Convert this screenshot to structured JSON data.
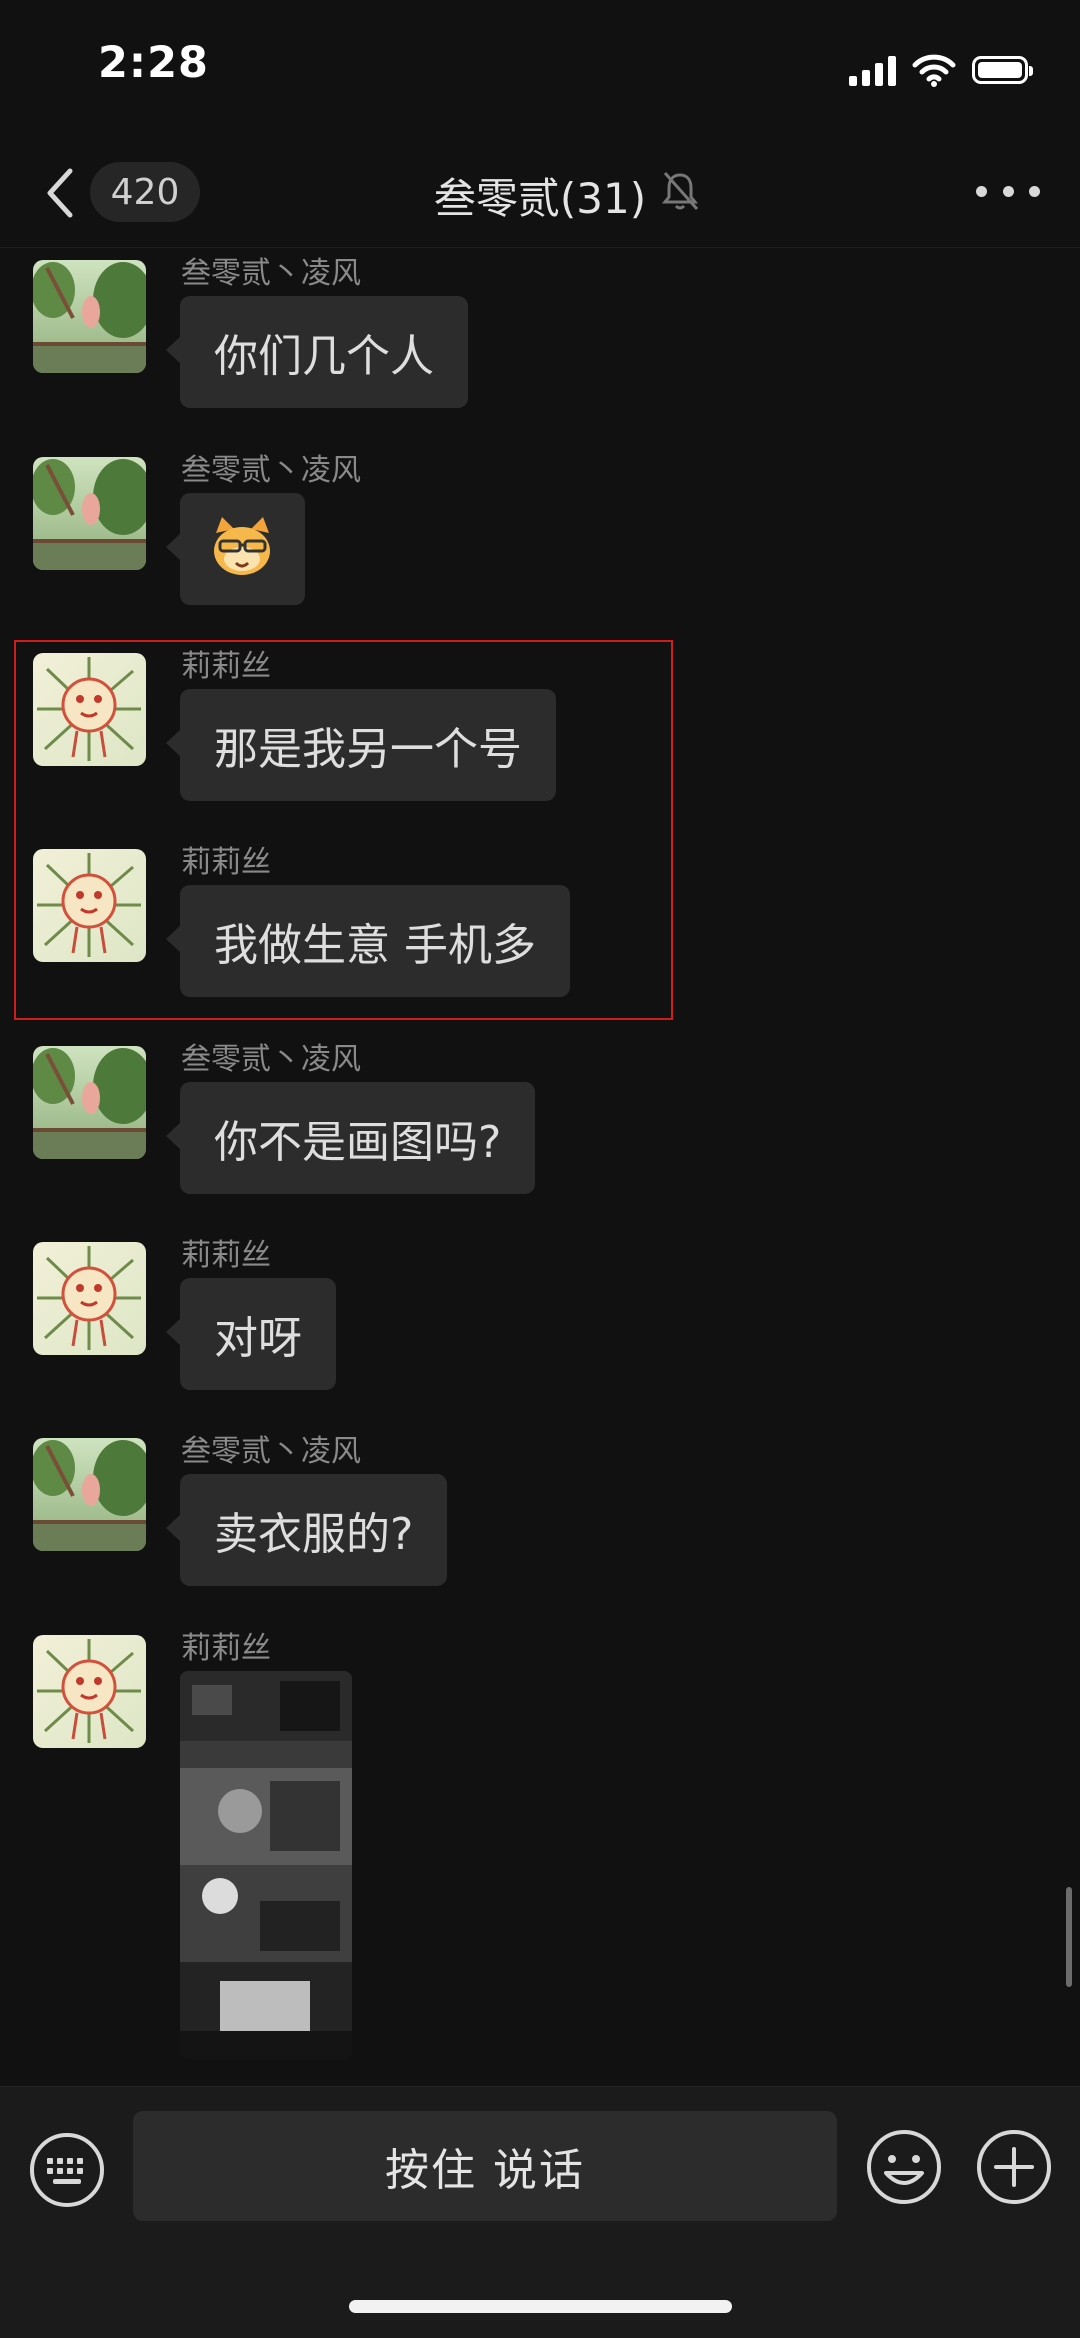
{
  "status_bar": {
    "time": "2:28"
  },
  "nav": {
    "unread_count": "420",
    "title": "叁零贰(31)"
  },
  "messages": [
    {
      "sender": "叁零贰丶凌风",
      "text": "你们几个人",
      "avatar": "tree-photo"
    },
    {
      "sender": "叁零贰丶凌风",
      "text": "",
      "sticker": "cat-with-glasses-emoji",
      "avatar": "tree-photo"
    },
    {
      "sender": "莉莉丝",
      "text": "那是我另一个号",
      "avatar": "lion-drawing"
    },
    {
      "sender": "莉莉丝",
      "text": "我做生意 手机多",
      "avatar": "lion-drawing"
    },
    {
      "sender": "叁零贰丶凌风",
      "text": "你不是画图吗?",
      "avatar": "tree-photo"
    },
    {
      "sender": "莉莉丝",
      "text": "对呀",
      "avatar": "lion-drawing"
    },
    {
      "sender": "叁零贰丶凌风",
      "text": "卖衣服的?",
      "avatar": "tree-photo"
    },
    {
      "sender": "莉莉丝",
      "text": "",
      "image": "black-and-white-photo-collage",
      "avatar": "lion-drawing"
    }
  ],
  "input_bar": {
    "voice_label": "按住 说话",
    "left_icon": "keyboard-icon",
    "right_icons": [
      "emoji-icon",
      "plus-icon"
    ]
  },
  "colors": {
    "background": "#111111",
    "bubble": "#2c2c2c",
    "highlight": "#d21c1c",
    "sender": "#8a8a8a"
  }
}
